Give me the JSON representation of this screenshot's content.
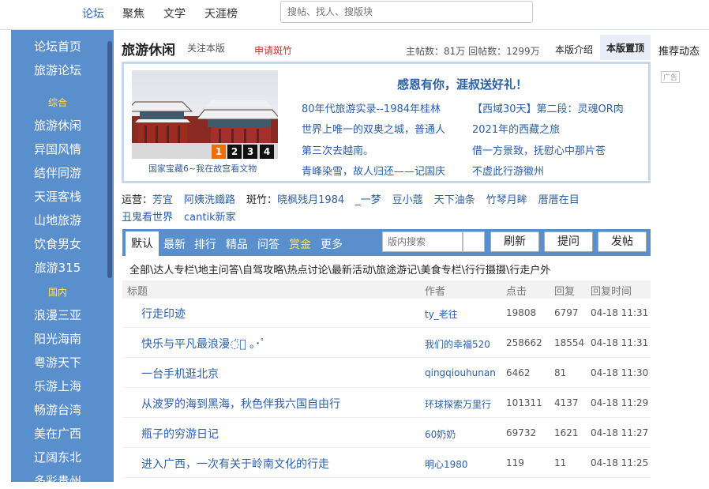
{
  "nav": {
    "items": [
      "论坛",
      "聚焦",
      "文学",
      "天涯榜"
    ],
    "search_placeholder": "搜帖、找人、搜版块"
  },
  "sidebar": {
    "top_items": [
      "论坛首页",
      "旅游论坛"
    ],
    "section1": "综合",
    "items1": [
      "旅游休闲",
      "异国风情",
      "结伴同游",
      "天涯客栈",
      "山地旅游",
      "饮食男女",
      "旅游315"
    ],
    "section2": "国内",
    "items2": [
      "浪漫三亚",
      "阳光海南",
      "粤游天下",
      "乐游上海",
      "畅游台湾",
      "美在广西",
      "辽阔东北",
      "多彩贵州"
    ]
  },
  "header": {
    "title": "旅游休闲",
    "follow": "关注本版",
    "apply": "申请斑竹",
    "stats": "主帖数：81万 回帖数：1299万",
    "intro": "本版介绍",
    "top": "本版置顶",
    "recommend": "推荐动态",
    "ad": "广告"
  },
  "feature": {
    "slide_numbers": [
      "1",
      "2",
      "3",
      "4"
    ],
    "active_slide": "1",
    "caption": "国家宝藏6~我在故宫看文物",
    "headline": "感恩有你，涯叔送好礼！",
    "links": [
      "80年代旅游实录--1984年桂林",
      "【西域30天】第二段：灵魂OR肉",
      "世界上唯一的双奥之城，普通人",
      "2021年的西藏之旅",
      "第三次去越南。",
      "借一方景致，抚慰心中那片苍",
      "青峰染雪，故人归还——记国庆",
      "不虚此行游徽州"
    ]
  },
  "moderators": {
    "ops_label": "运营：",
    "ops": [
      "芳宜",
      "阿姨洗鐵路"
    ],
    "mods_label": "斑竹：",
    "mods_row1": [
      "晓枫残月1984",
      "_一梦",
      "豆小蔻",
      "天下油条",
      "竹琴月眸",
      "厝厝在目"
    ],
    "mods_row2": [
      "丑鬼看世界",
      "cantik新家"
    ]
  },
  "tabs": {
    "items": [
      "默认",
      "最新",
      "排行",
      "精品",
      "问答",
      "赏金",
      "更多"
    ],
    "highlight_color": "#ffe14f",
    "search_placeholder": "版内搜索",
    "buttons": [
      "刷新",
      "提问",
      "发帖"
    ]
  },
  "filter": "全部\\达人专栏\\地主问答\\自驾攻略\\热点讨论\\最新活动\\旅途游记\\美食专栏\\行行摄摄\\行走户外",
  "table": {
    "headers": [
      "标题",
      "作者",
      "点击",
      "回复",
      "回复时间"
    ],
    "rows": [
      {
        "title": "行走印迹",
        "author": "ty_老往",
        "clicks": "19808",
        "replies": "6797",
        "time": "04-18 11:31"
      },
      {
        "title": "快乐与平凡最浪漫◌̈⃝ ｡･ﾟ",
        "author": "我们的幸福520",
        "clicks": "258662",
        "replies": "18554",
        "time": "04-18 11:31"
      },
      {
        "title": "一台手机逛北京",
        "author": "qingqiouhunan",
        "clicks": "6462",
        "replies": "81",
        "time": "04-18 11:30"
      },
      {
        "title": "从波罗的海到黑海，秋色伴我六国自由行",
        "author": "环球探索万里行",
        "clicks": "101311",
        "replies": "4137",
        "time": "04-18 11:29"
      },
      {
        "title": "瓶子的穷游日记",
        "author": "60奶奶",
        "clicks": "69732",
        "replies": "1621",
        "time": "04-18 11:27"
      },
      {
        "title": "进入广西，一次有关于岭南文化的行走",
        "author": "明心1980",
        "clicks": "119",
        "replies": "11",
        "time": "04-18 11:25"
      }
    ]
  }
}
